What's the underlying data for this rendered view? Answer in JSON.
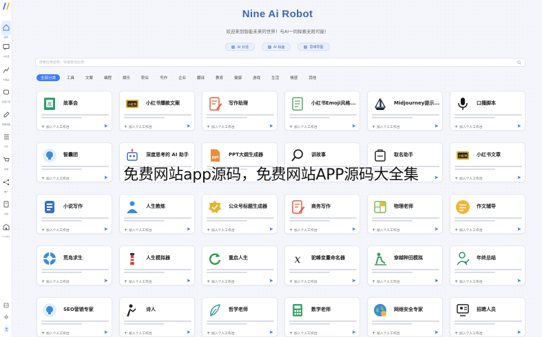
{
  "app": {
    "title": "Nine Ai Robot",
    "subtitle": "欢迎来到智能未来的世界！与AI一同探索无限可能！",
    "colors": {
      "accent": "#3b7bff",
      "title": "#3a67b3"
    }
  },
  "sidebar": {
    "items": [
      {
        "label": "首页",
        "icon": "home-icon",
        "active": true
      },
      {
        "label": "AI对话",
        "icon": "chat-icon"
      },
      {
        "label": "AI绘画",
        "icon": "chart-icon"
      },
      {
        "label": "应用广场",
        "icon": "app-icon"
      },
      {
        "label": "思维导图",
        "icon": "edit-icon"
      },
      {
        "label": "分享",
        "icon": "list-icon"
      },
      {
        "label": "商城",
        "icon": "cart-icon"
      },
      {
        "label": "推广",
        "icon": "share-icon"
      },
      {
        "label": "文档",
        "icon": "doc-icon"
      },
      {
        "label": "个人中心",
        "icon": "building-icon"
      }
    ]
  },
  "top_buttons": [
    {
      "label": "AI 对话",
      "icon": "chat-icon"
    },
    {
      "label": "AI 绘画",
      "icon": "brush-icon"
    },
    {
      "label": "思维导图",
      "icon": "mindmap-icon"
    }
  ],
  "search": {
    "placeholder": "搜索应用名称、快速查找应用"
  },
  "categories": [
    "全部分类",
    "工具",
    "文案",
    "编程",
    "娱乐",
    "职业",
    "写作",
    "企业",
    "翻译",
    "教育",
    "健康",
    "游戏",
    "生活",
    "情感",
    "其他"
  ],
  "card_add_label": "加入个人工作台",
  "cards": [
    {
      "name": "故事会",
      "icon": "book-icon",
      "color": "#2e9e6b"
    },
    {
      "name": "小红书爆款文案",
      "icon": "note-tag-icon",
      "color": "#d9a72a"
    },
    {
      "name": "写作助理",
      "icon": "pen-doc-icon",
      "color": "#e55a3c"
    },
    {
      "name": "小红书Emoji风格...",
      "icon": "notebook-icon",
      "color": "#5aa35a"
    },
    {
      "name": "Midjourney提示...",
      "icon": "ship-icon",
      "color": "#1b2a3a"
    },
    {
      "name": "口播脚本",
      "icon": "mic-icon",
      "color": "#111111"
    },
    {
      "name": "智囊团",
      "icon": "bulb-icon",
      "color": "#3a8bdc"
    },
    {
      "name": "深度思考的 AI 助手",
      "icon": "robot-icon",
      "color": "#3a6fc4"
    },
    {
      "name": "PPT大纲生成器",
      "icon": "ppt-icon",
      "color": "#f08a3c"
    },
    {
      "name": "讲故事",
      "icon": "magnifier-icon",
      "color": "#222222"
    },
    {
      "name": "取名助手",
      "icon": "name-tag-icon",
      "color": "#222222"
    },
    {
      "name": "小红书文章",
      "icon": "note-tag-icon",
      "color": "#d9a72a"
    },
    {
      "name": "小说写作",
      "icon": "doc-blue-icon",
      "color": "#3a6fc4"
    },
    {
      "name": "人生教练",
      "icon": "coach-icon",
      "color": "#3a8bdc"
    },
    {
      "name": "公众号标题生成器",
      "icon": "badge-icon",
      "color": "#e8b32a"
    },
    {
      "name": "商务写作",
      "icon": "pen-doc-icon",
      "color": "#e55a3c"
    },
    {
      "name": "物理老师",
      "icon": "layout-icon",
      "color": "#7ab84a"
    },
    {
      "name": "作文辅导",
      "icon": "list-circle-icon",
      "color": "#f2b632"
    },
    {
      "name": "荒岛求生",
      "icon": "lifebuoy-icon",
      "color": "#3a8bdc"
    },
    {
      "name": "人生模拟器",
      "icon": "lighthouse-icon",
      "color": "#c94a3a"
    },
    {
      "name": "重启人生",
      "icon": "restart-icon",
      "color": "#2e9e4b"
    },
    {
      "name": "驼峰变量命名器",
      "icon": "x-variable-icon",
      "color": "#222222"
    },
    {
      "name": "穿越种田模拟",
      "icon": "farmer-icon",
      "color": "#3a9e5a"
    },
    {
      "name": "年终总结",
      "icon": "person-check-icon",
      "color": "#2e8e6b"
    },
    {
      "name": "SEO营销专家",
      "icon": "bulb-icon",
      "color": "#3a8bdc"
    },
    {
      "name": "诗人",
      "icon": "poet-icon",
      "color": "#222222"
    },
    {
      "name": "哲学老师",
      "icon": "feather-icon",
      "color": "#2e9e9e"
    },
    {
      "name": "数学老师",
      "icon": "calc-icon",
      "color": "#3aa36b"
    },
    {
      "name": "网络安全专家",
      "icon": "globe-icon",
      "color": "#3a8bdc"
    },
    {
      "name": "招聘人员",
      "icon": "recruit-icon",
      "color": "#222222"
    }
  ],
  "overlay": {
    "watermark": "免费网站app源码，免费网站APP源码大全集"
  }
}
